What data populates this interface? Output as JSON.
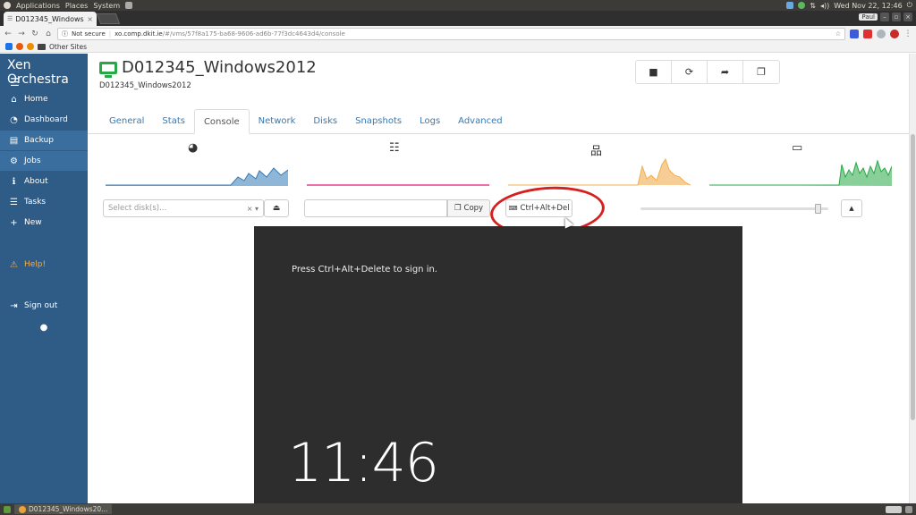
{
  "topbar": {
    "menus": [
      "Applications",
      "Places",
      "System"
    ],
    "datetime": "Wed Nov 22, 12:46"
  },
  "browser": {
    "tab_title": "D012345_Windows",
    "user": "Paul",
    "security": "Not secure",
    "url_host": "xo.comp.dkit.ie",
    "url_path": "/#/vms/57f8a175-ba68-9606-ad6b-77f3dc4643d4/console",
    "bookmarks": [
      "Other Sites"
    ]
  },
  "sidebar": {
    "brand": "Xen Orchestra",
    "items": [
      {
        "label": "Home",
        "icon": "home-icon"
      },
      {
        "label": "Dashboard",
        "icon": "dashboard-icon"
      },
      {
        "label": "Backup",
        "icon": "backup-icon"
      },
      {
        "label": "Jobs",
        "icon": "jobs-icon"
      },
      {
        "label": "About",
        "icon": "info-icon"
      },
      {
        "label": "Tasks",
        "icon": "tasks-icon"
      },
      {
        "label": "New",
        "icon": "plus-icon"
      },
      {
        "label": "Help!",
        "icon": "warning-icon"
      },
      {
        "label": "Sign out",
        "icon": "sign-out-icon"
      }
    ]
  },
  "vm": {
    "name": "D012345_Windows2012",
    "description": "D012345_Windows2012"
  },
  "tabs": [
    "General",
    "Stats",
    "Console",
    "Network",
    "Disks",
    "Snapshots",
    "Logs",
    "Advanced"
  ],
  "console_controls": {
    "disk_placeholder": "Select disk(s)...",
    "copy_label": "Copy",
    "cad_label": "Ctrl+Alt+Del"
  },
  "console_screen": {
    "message": "Press Ctrl+Alt+Delete to sign in.",
    "clock": "11:46"
  },
  "taskbar": {
    "window": "D012345_Windows20..."
  },
  "colors": {
    "sidebar": "#2f5c86",
    "cpu": "#337ab7",
    "memory": "#e83e8c",
    "network": "#f0ad4e",
    "disk": "#28a745",
    "highlight": "#d62020"
  }
}
